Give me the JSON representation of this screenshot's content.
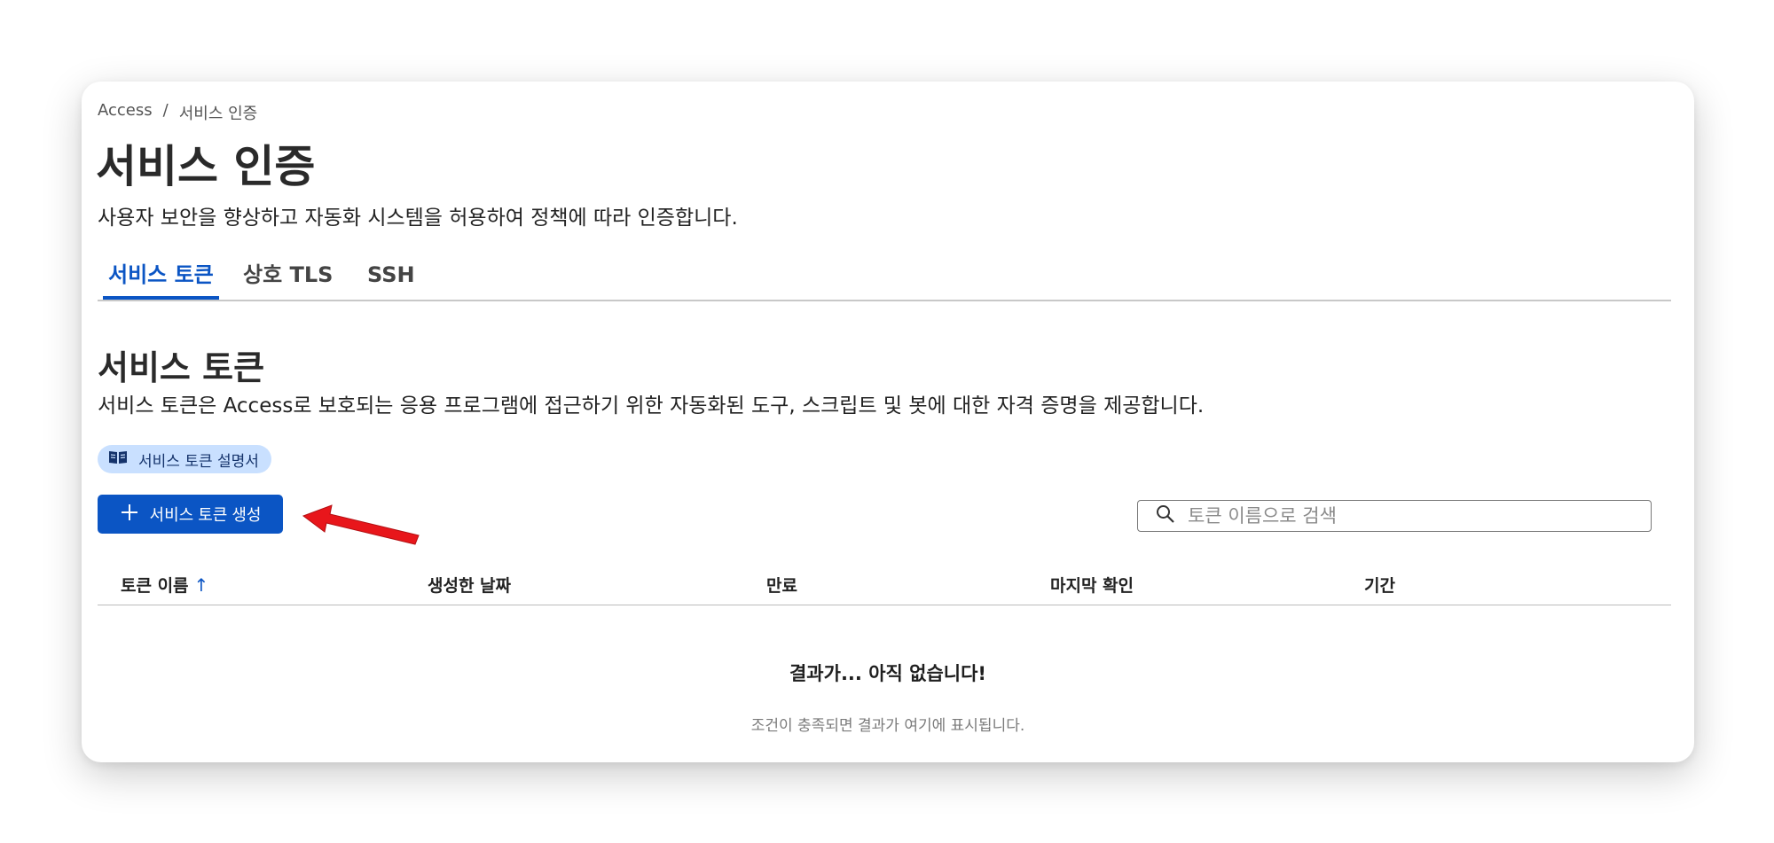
{
  "breadcrumb": {
    "root": "Access",
    "separator": "/",
    "current": "서비스 인증"
  },
  "page": {
    "title": "서비스 인증",
    "description": "사용자 보안을 향상하고 자동화 시스템을 허용하여 정책에 따라 인증합니다."
  },
  "tabs": [
    {
      "label": "서비스 토큰",
      "active": true
    },
    {
      "label": "상호 TLS",
      "active": false
    },
    {
      "label": "SSH",
      "active": false
    }
  ],
  "section": {
    "title": "서비스 토큰",
    "description": "서비스 토큰은 Access로 보호되는 응용 프로그램에 접근하기 위한 자동화된 도구, 스크립트 및 봇에 대한 자격 증명을 제공합니다."
  },
  "doc_link": {
    "label": "서비스 토큰 설명서",
    "icon": "book-icon"
  },
  "create_button": {
    "label": "서비스 토큰 생성",
    "icon": "plus-icon"
  },
  "search": {
    "placeholder": "토큰 이름으로 검색",
    "value": "",
    "icon": "search-icon"
  },
  "table": {
    "columns": [
      {
        "label": "토큰 이름",
        "sort": "ascending"
      },
      {
        "label": "생성한 날짜"
      },
      {
        "label": "만료"
      },
      {
        "label": "마지막 확인"
      },
      {
        "label": "기간"
      }
    ],
    "rows": []
  },
  "empty_state": {
    "title": "결과가... 아직 없습니다!",
    "subtitle": "조건이 충족되면 결과가 여기에 표시됩니다."
  },
  "colors": {
    "accent": "#0b55c4",
    "pill_bg": "#c9e0ff",
    "annotation_arrow": "#e8161b"
  }
}
